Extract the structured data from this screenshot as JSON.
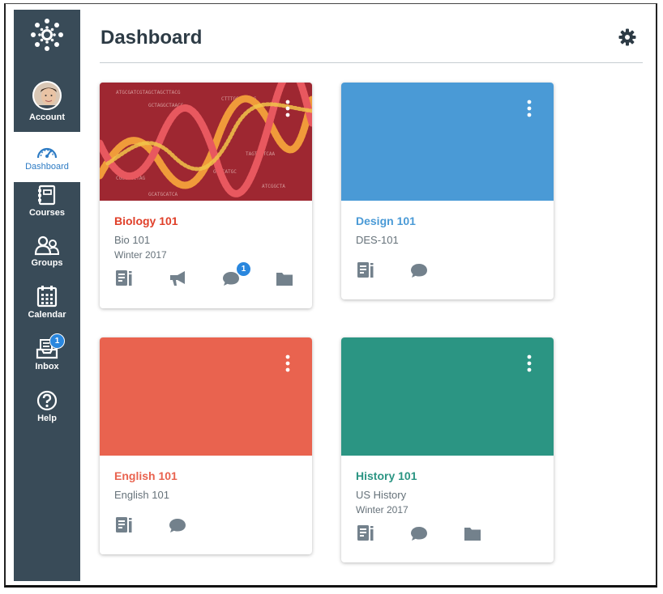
{
  "sidebar": {
    "account_label": "Account",
    "dashboard_label": "Dashboard",
    "courses_label": "Courses",
    "groups_label": "Groups",
    "calendar_label": "Calendar",
    "inbox_label": "Inbox",
    "inbox_badge": "1",
    "help_label": "Help",
    "colors": {
      "bg": "#394b58",
      "active": "#2d7bc4"
    }
  },
  "header": {
    "title": "Dashboard"
  },
  "cards": [
    {
      "title": "Biology 101",
      "code": "Bio 101",
      "term": "Winter 2017",
      "color": "#e0402a",
      "hero": "dna-image",
      "discussion_badge": "1",
      "actions": [
        "assignments-icon",
        "announcements-icon",
        "discussions-icon",
        "files-icon"
      ]
    },
    {
      "title": "Design 101",
      "code": "DES-101",
      "term": "",
      "color": "#4a9ad6",
      "actions": [
        "assignments-icon",
        "discussions-icon"
      ]
    },
    {
      "title": "English 101",
      "code": "English 101",
      "term": "",
      "color": "#e9634f",
      "actions": [
        "assignments-icon",
        "discussions-icon"
      ]
    },
    {
      "title": "History 101",
      "code": "US History",
      "term": "Winter 2017",
      "color": "#2b9583",
      "actions": [
        "assignments-icon",
        "discussions-icon",
        "files-icon"
      ]
    }
  ]
}
